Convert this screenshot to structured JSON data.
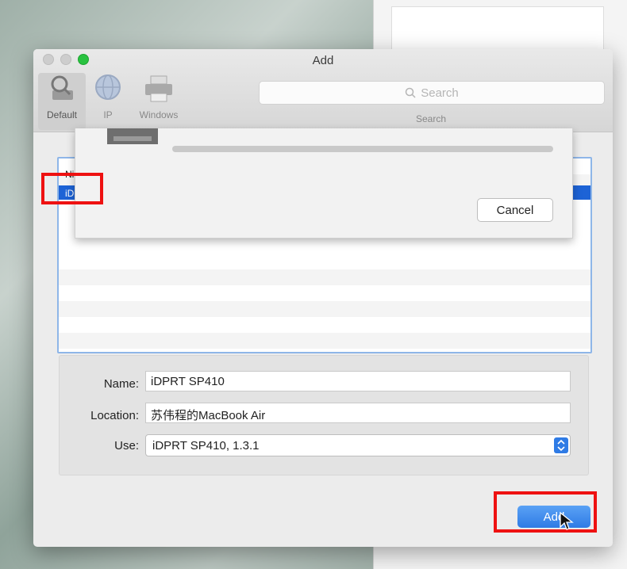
{
  "dialog": {
    "title": "Add",
    "toolbar": {
      "tabs": [
        {
          "label": "Default",
          "icon": "magnifier-printer-icon"
        },
        {
          "label": "IP",
          "icon": "globe-icon"
        },
        {
          "label": "Windows",
          "icon": "printer-icon"
        }
      ],
      "search": {
        "placeholder": "Search",
        "caption": "Search"
      }
    },
    "printer_list": {
      "rows": [
        {
          "label": "Ni",
          "selected": false
        },
        {
          "label": "iD",
          "selected": true
        }
      ]
    },
    "progress_sheet": {
      "cancel_label": "Cancel"
    },
    "form": {
      "name_label": "Name:",
      "name_value": "iDPRT SP410",
      "location_label": "Location:",
      "location_value": "苏伟程的MacBook Air",
      "use_label": "Use:",
      "use_value": "iDPRT SP410, 1.3.1"
    },
    "add_label": "Add"
  },
  "colors": {
    "selection": "#1d63d6",
    "highlight": "#e11111",
    "accent_button": "#2f7be5"
  }
}
